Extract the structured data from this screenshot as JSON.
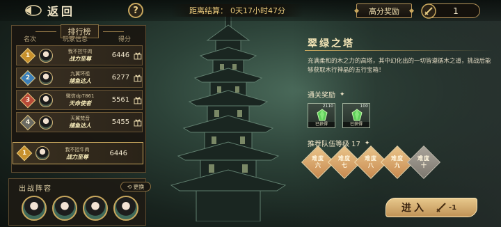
{
  "header": {
    "back_label": "返回",
    "help_label": "?",
    "countdown_label": "距离结算：",
    "countdown_value": "0天17小时47分",
    "high_score_reward_label": "高分奖励",
    "ticket_count": "1"
  },
  "leaderboard": {
    "title": "排行榜",
    "col_rank": "名次",
    "col_info": "玩家信息",
    "col_score": "得分",
    "rows": [
      {
        "rank": "1",
        "name": "我不控牛肉",
        "title": "战力至尊",
        "score": "6446",
        "badge_color": "#c7902c"
      },
      {
        "rank": "2",
        "name": "九翼环祖",
        "title": "捕鱼达人",
        "score": "6277",
        "badge_color": "#3c7fb8"
      },
      {
        "rank": "3",
        "name": "微信dp7861",
        "title": "天命使者",
        "score": "5561",
        "badge_color": "#b84a38"
      },
      {
        "rank": "4",
        "name": "天翼梵音",
        "title": "捕鱼达人",
        "score": "5455",
        "badge_color": "#6a6a62"
      }
    ],
    "my_row": {
      "rank": "1",
      "name": "我不控牛肉",
      "title": "战力至尊",
      "score": "6446",
      "badge_color": "#c7902c"
    }
  },
  "deploy": {
    "title": "出战阵容",
    "change_label": "更换"
  },
  "tower": {
    "title": "翠绿之塔",
    "description": "充满柔和的木之力的高塔，其中幻化出的一切皆遵循木之道，挑战后能够获取木行神晶的五行宝箱！",
    "clear_reward_label": "通关奖励",
    "rewards": [
      {
        "qty": "2110",
        "status": "已获得",
        "icon": "green-crystal-icon"
      },
      {
        "qty": "100",
        "status": "已获得",
        "icon": "green-crystal-icon"
      }
    ],
    "recommend_label": "推荐队伍等级 17",
    "difficulties": [
      {
        "word": "难度",
        "num": "六",
        "locked": false
      },
      {
        "word": "难度",
        "num": "七",
        "locked": false
      },
      {
        "word": "难度",
        "num": "八",
        "locked": false
      },
      {
        "word": "难度",
        "num": "九",
        "locked": false
      },
      {
        "word": "难度",
        "num": "十",
        "locked": true
      }
    ]
  },
  "enter": {
    "label": "进入",
    "cost": "-1"
  }
}
